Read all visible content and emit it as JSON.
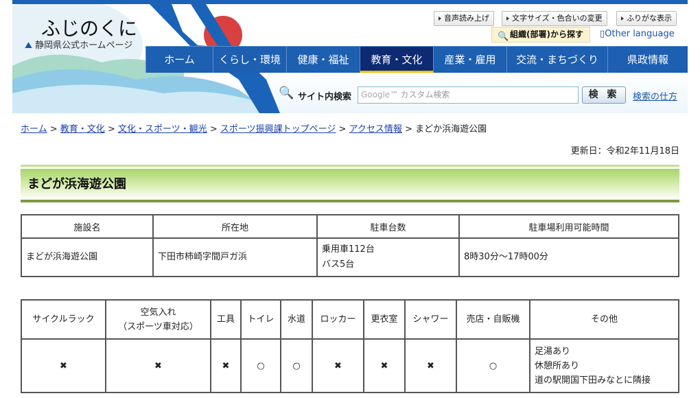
{
  "header": {
    "logo": "ふじのくに",
    "logo_sub": "静岡県公式ホームページ",
    "utility": [
      "音声読み上げ",
      "文字サイズ・色合いの変更",
      "ふりがな表示"
    ],
    "org_search": "組織(部署)から探す",
    "other_language": "Other language"
  },
  "nav": {
    "items": [
      "ホーム",
      "くらし・環境",
      "健康・福祉",
      "教育・文化",
      "産業・雇用",
      "交流・まちづくり",
      "県政情報"
    ],
    "active": "教育・文化"
  },
  "search": {
    "label": "サイト内検索",
    "placeholder_brand": "Google™",
    "placeholder": "カスタム検索",
    "button": "検 索",
    "help": "検索の仕方"
  },
  "breadcrumb": {
    "links": [
      "ホーム",
      "教育・文化",
      "文化・スポーツ・観光",
      "スポーツ振興課トップページ",
      "アクセス情報"
    ],
    "current": "まどか浜海遊公園"
  },
  "updated": "更新日：令和2年11月18日",
  "title": "まどが浜海遊公園",
  "table1": {
    "headers": [
      "施設名",
      "所在地",
      "駐車台数",
      "駐車場利用可能時間"
    ],
    "row": {
      "name": "まどが浜海遊公園",
      "address": "下田市柿崎字間戸ガ浜",
      "parking": [
        "乗用車112台",
        "バス5台"
      ],
      "hours": "8時30分～17時00分"
    }
  },
  "table2": {
    "headers": [
      "サイクルラック",
      "空気入れ",
      "（スポーツ車対応）",
      "工具",
      "トイレ",
      "水道",
      "ロッカー",
      "更衣室",
      "シャワー",
      "売店・自販機",
      "その他"
    ],
    "row": [
      "✖",
      "✖",
      "✖",
      "○",
      "○",
      "✖",
      "✖",
      "✖",
      "○"
    ],
    "other": [
      "足湯あり",
      "休憩所あり",
      "道の駅開国下田みなとに隣接"
    ]
  },
  "colors": {
    "nav": "#1d5fb0",
    "nav_active": "#0d2a72",
    "heading_green": "#a8d46a"
  }
}
